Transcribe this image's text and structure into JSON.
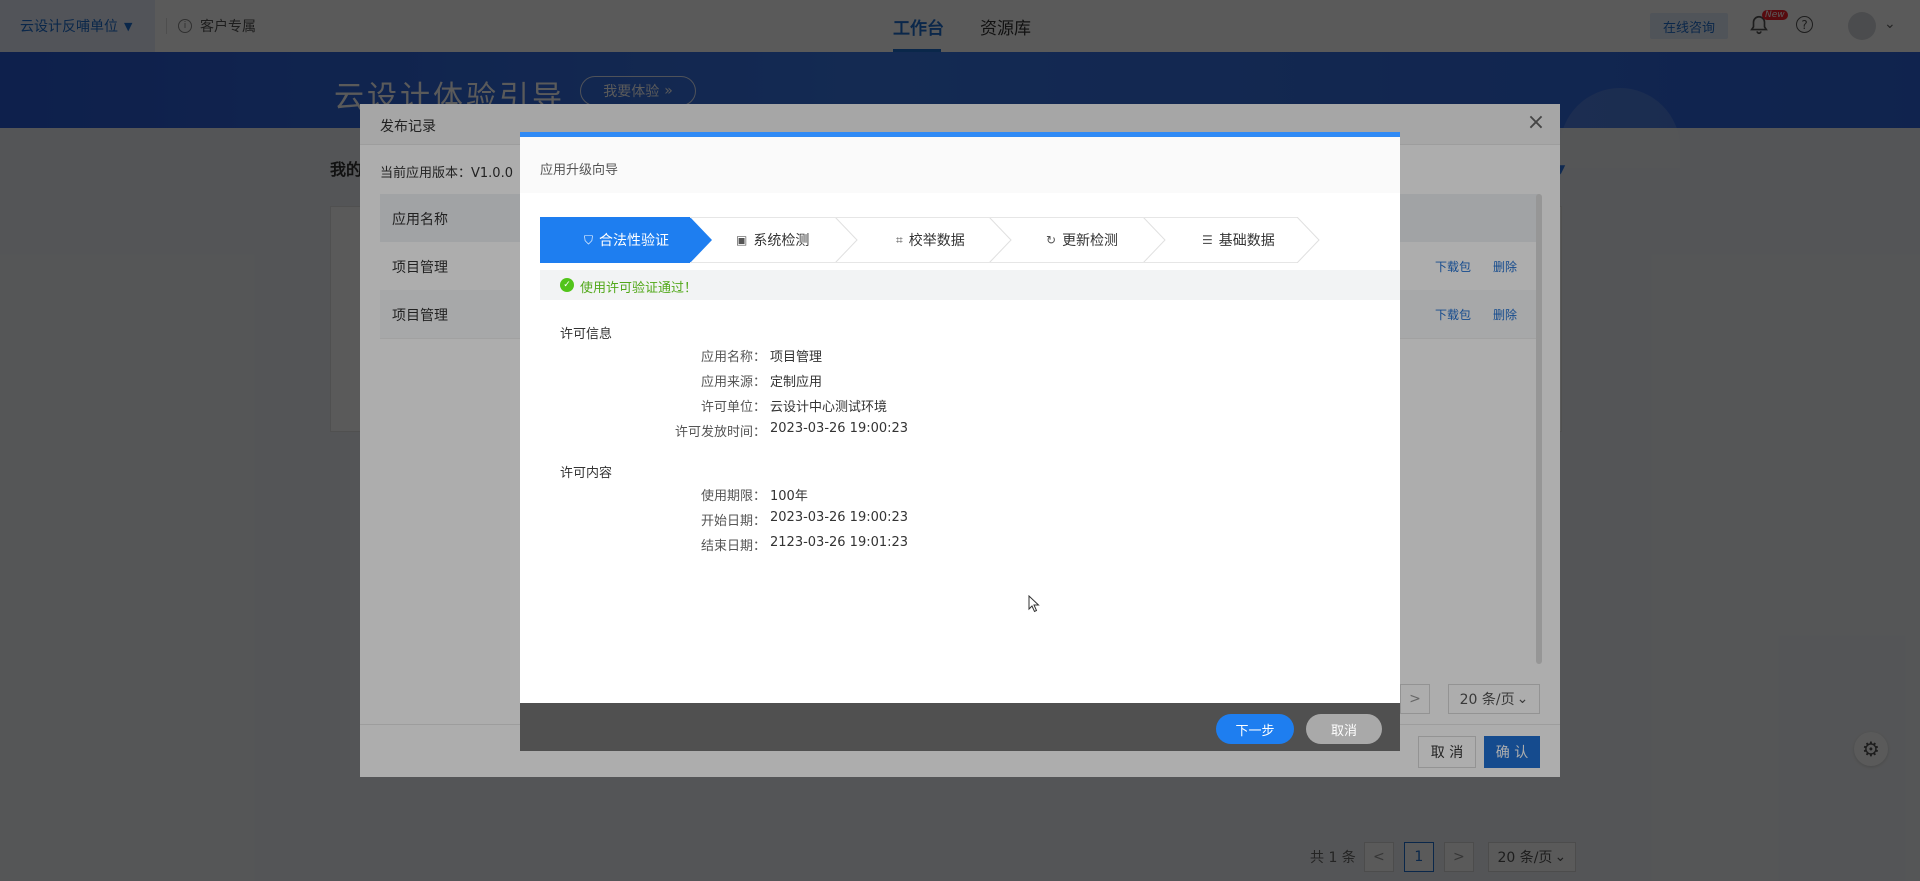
{
  "topbar": {
    "org_label": "云设计反哺单位",
    "customer_label": "客户专属",
    "tabs": [
      {
        "label": "工作台"
      },
      {
        "label": "资源库"
      }
    ],
    "consult_label": "在线咨询",
    "new_badge": "New"
  },
  "banner": {
    "title": "云设计体验引导",
    "button_label": "我要体验"
  },
  "page": {
    "section_title": "我的"
  },
  "bottom_pager": {
    "total": "共 1 条",
    "prev": "<",
    "current": "1",
    "next": ">",
    "page_size": "20 条/页"
  },
  "publish_dialog": {
    "title": "发布记录",
    "current_version": "当前应用版本：V1.0.0",
    "column_header": "应用名称",
    "rows": [
      {
        "name": "项目管理",
        "download": "下载包",
        "delete": "删除"
      },
      {
        "name": "项目管理",
        "download": "下载包",
        "delete": "删除"
      }
    ],
    "pager_next": ">",
    "page_size": "20 条/页",
    "cancel_label": "取 消",
    "confirm_label": "确 认"
  },
  "wizard": {
    "title": "应用升级向导",
    "steps": [
      {
        "label": "合法性验证",
        "icon": "shield-check-icon",
        "active": true
      },
      {
        "label": "系统检测",
        "icon": "monitor-icon",
        "active": false
      },
      {
        "label": "校举数据",
        "icon": "scan-icon",
        "active": false
      },
      {
        "label": "更新检测",
        "icon": "refresh-icon",
        "active": false
      },
      {
        "label": "基础数据",
        "icon": "document-icon",
        "active": false
      }
    ],
    "result_message": "使用许可验证通过！",
    "license_info": {
      "heading": "许可信息",
      "items": [
        {
          "key": "应用名称：",
          "value": "项目管理"
        },
        {
          "key": "应用来源：",
          "value": "定制应用"
        },
        {
          "key": "许可单位：",
          "value": "云设计中心测试环境"
        },
        {
          "key": "许可发放时间：",
          "value": "2023-03-26 19:00:23"
        }
      ]
    },
    "license_content": {
      "heading": "许可内容",
      "items": [
        {
          "key": "使用期限：",
          "value": "100年"
        },
        {
          "key": "开始日期：",
          "value": "2023-03-26 19:00:23"
        },
        {
          "key": "结束日期：",
          "value": "2123-03-26 19:01:23"
        }
      ]
    },
    "next_label": "下一步",
    "cancel_label": "取消"
  },
  "colors": {
    "primary": "#1f6fd1",
    "step_active": "#1e7ef0",
    "success": "#52c41a",
    "footer": "#505050"
  }
}
